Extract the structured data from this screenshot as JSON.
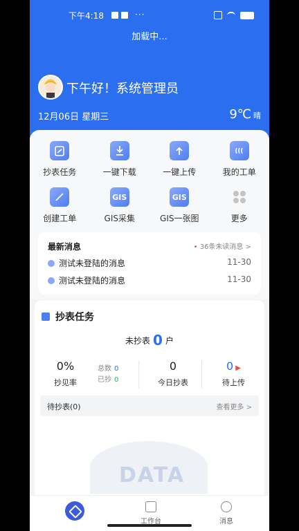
{
  "status": {
    "time": "下午4:18",
    "dots": "···"
  },
  "header": {
    "loading": "加载中...",
    "greeting": "下午好！系统管理员",
    "date": "12月06日 星期三",
    "temperature": "9℃",
    "weather": "晴"
  },
  "grid": [
    {
      "label": "抄表任务",
      "icon": "clipboard-icon"
    },
    {
      "label": "一键下载",
      "icon": "download-icon"
    },
    {
      "label": "一键上传",
      "icon": "upload-icon"
    },
    {
      "label": "我的工单",
      "icon": "ticket-icon"
    },
    {
      "label": "创建工单",
      "icon": "edit-icon"
    },
    {
      "label": "GIS采集",
      "icon": "gis-icon"
    },
    {
      "label": "GIS一张图",
      "icon": "gis-map-icon"
    },
    {
      "label": "更多",
      "icon": "more-grid-icon"
    }
  ],
  "messages": {
    "title": "最新消息",
    "unread": "36条未读消息 >",
    "items": [
      {
        "text": "测试未登陆的消息",
        "time": "11-30"
      },
      {
        "text": "测试未登陆的消息",
        "time": "11-30"
      }
    ]
  },
  "task": {
    "title": "抄表任务",
    "unread_prefix": "未抄表",
    "unread_num": "0",
    "unread_unit": "户",
    "rate_value": "0%",
    "rate_label": "抄见率",
    "total_label": "总数",
    "total_value": "0",
    "done_label": "已抄",
    "done_value": "0",
    "today_value": "0",
    "today_label": "今日抄表",
    "upload_value": "0",
    "upload_label": "待上传",
    "pending_label": "待抄表(0)",
    "more_label": "查看更多 >",
    "empty_text": "DATA"
  },
  "tabs": [
    {
      "label": "",
      "icon": "home-icon"
    },
    {
      "label": "工作台",
      "icon": "workbench-icon"
    },
    {
      "label": "消息",
      "icon": "message-icon"
    }
  ],
  "colors": {
    "primary": "#2b6ff0",
    "accent_red": "#e74c3c"
  }
}
